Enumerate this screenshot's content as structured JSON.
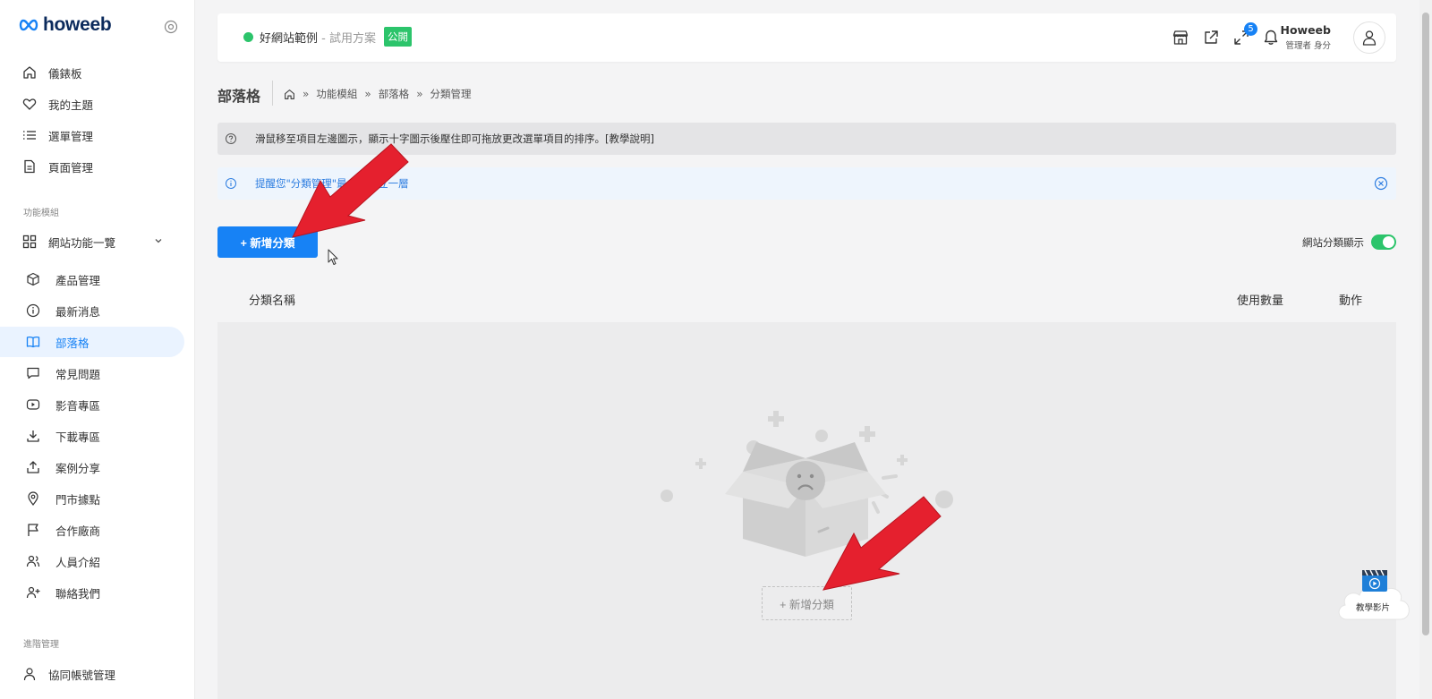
{
  "brand": {
    "logo_text": "howeeb",
    "logo_color": "#1782f5"
  },
  "sidebar": {
    "top_items": [
      {
        "label": "儀錶板",
        "icon": "home-icon"
      },
      {
        "label": "我的主題",
        "icon": "heart-icon"
      },
      {
        "label": "選單管理",
        "icon": "list-icon"
      },
      {
        "label": "頁面管理",
        "icon": "document-icon"
      }
    ],
    "section_modules": "功能模組",
    "modules_group": {
      "label": "網站功能一覽",
      "icon": "grid-icon",
      "expanded": true
    },
    "module_items": [
      {
        "label": "產品管理",
        "icon": "box-icon"
      },
      {
        "label": "最新消息",
        "icon": "info-icon"
      },
      {
        "label": "部落格",
        "icon": "book-icon",
        "active": true
      },
      {
        "label": "常見問題",
        "icon": "chat-icon"
      },
      {
        "label": "影音專區",
        "icon": "video-icon"
      },
      {
        "label": "下載專區",
        "icon": "download-icon"
      },
      {
        "label": "案例分享",
        "icon": "share-icon"
      },
      {
        "label": "門市據點",
        "icon": "map-pin-icon"
      },
      {
        "label": "合作廠商",
        "icon": "flag-icon"
      },
      {
        "label": "人員介紹",
        "icon": "users-icon"
      },
      {
        "label": "聯絡我們",
        "icon": "user-plus-icon"
      }
    ],
    "section_admin": "進階管理",
    "admin_items": [
      {
        "label": "協同帳號管理",
        "icon": "user-icon"
      }
    ]
  },
  "topbar": {
    "site_name": "好網站範例",
    "separator": " - ",
    "plan": "試用方案",
    "badge": "公開",
    "notification_count": "5",
    "user_name": "Howeeb",
    "user_role": "管理者 身分",
    "status_color": "#2cc46b"
  },
  "page": {
    "title": "部落格",
    "breadcrumb": [
      "功能模組",
      "部落格",
      "分類管理"
    ],
    "notice_tip": "滑鼠移至項目左邊圖示，顯示十字圖示後壓住即可拖放更改選單項目的排序。[教學說明]",
    "notice_info": "提醒您\"分類管理\"最多可建立一層",
    "add_button": "+ 新增分類",
    "toggle_label": "網站分類顯示",
    "toggle_on": true
  },
  "table": {
    "columns": [
      "分類名稱",
      "使用數量",
      "動作"
    ],
    "empty_add": "+ 新增分類"
  },
  "tutorial": {
    "label": "教學影片"
  },
  "colors": {
    "primary": "#1782f5",
    "success": "#2cc46b",
    "arrow": "#e5202e"
  }
}
